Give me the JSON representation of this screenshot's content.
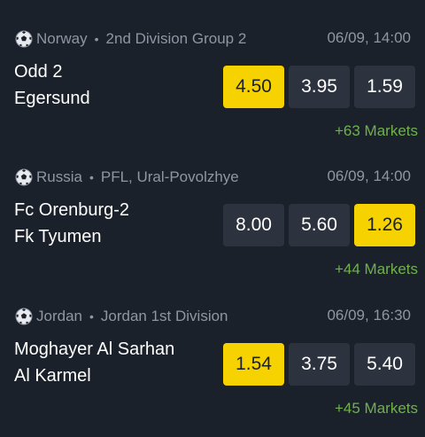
{
  "colors": {
    "background": "#1b212b",
    "odd_button": "#2c333f",
    "odd_selected": "#f6d200",
    "markets_link": "#6fb14a",
    "meta_text": "#8f96a3"
  },
  "matches": [
    {
      "country": "Norway",
      "league": "2nd Division Group 2",
      "datetime": "06/09, 14:00",
      "home": "Odd 2",
      "away": "Egersund",
      "odds": [
        "4.50",
        "3.95",
        "1.59"
      ],
      "selected_odd_index": 0,
      "markets": "+63 Markets",
      "icon": "soccer-ball-icon"
    },
    {
      "country": "Russia",
      "league": "PFL, Ural-Povolzhye",
      "datetime": "06/09, 14:00",
      "home": "Fc Orenburg-2",
      "away": "Fk Tyumen",
      "odds": [
        "8.00",
        "5.60",
        "1.26"
      ],
      "selected_odd_index": 2,
      "markets": "+44 Markets",
      "icon": "soccer-ball-icon"
    },
    {
      "country": "Jordan",
      "league": "Jordan 1st Division",
      "datetime": "06/09, 16:30",
      "home": "Moghayer Al Sarhan",
      "away": "Al Karmel",
      "odds": [
        "1.54",
        "3.75",
        "5.40"
      ],
      "selected_odd_index": 0,
      "markets": "+45 Markets",
      "icon": "soccer-ball-icon"
    }
  ]
}
